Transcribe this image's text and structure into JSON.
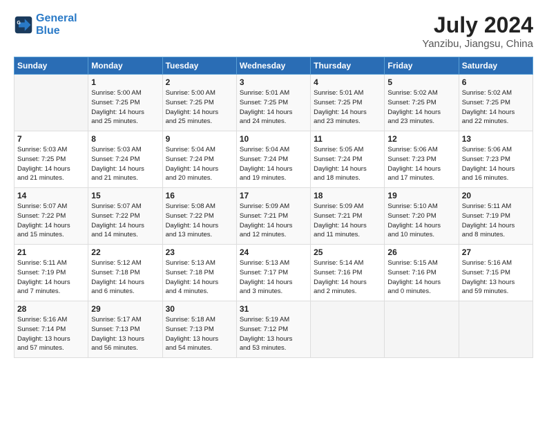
{
  "header": {
    "logo_line1": "General",
    "logo_line2": "Blue",
    "title": "July 2024",
    "subtitle": "Yanzibu, Jiangsu, China"
  },
  "weekdays": [
    "Sunday",
    "Monday",
    "Tuesday",
    "Wednesday",
    "Thursday",
    "Friday",
    "Saturday"
  ],
  "weeks": [
    [
      {
        "day": "",
        "info": ""
      },
      {
        "day": "1",
        "info": "Sunrise: 5:00 AM\nSunset: 7:25 PM\nDaylight: 14 hours\nand 25 minutes."
      },
      {
        "day": "2",
        "info": "Sunrise: 5:00 AM\nSunset: 7:25 PM\nDaylight: 14 hours\nand 25 minutes."
      },
      {
        "day": "3",
        "info": "Sunrise: 5:01 AM\nSunset: 7:25 PM\nDaylight: 14 hours\nand 24 minutes."
      },
      {
        "day": "4",
        "info": "Sunrise: 5:01 AM\nSunset: 7:25 PM\nDaylight: 14 hours\nand 23 minutes."
      },
      {
        "day": "5",
        "info": "Sunrise: 5:02 AM\nSunset: 7:25 PM\nDaylight: 14 hours\nand 23 minutes."
      },
      {
        "day": "6",
        "info": "Sunrise: 5:02 AM\nSunset: 7:25 PM\nDaylight: 14 hours\nand 22 minutes."
      }
    ],
    [
      {
        "day": "7",
        "info": "Sunrise: 5:03 AM\nSunset: 7:25 PM\nDaylight: 14 hours\nand 21 minutes."
      },
      {
        "day": "8",
        "info": "Sunrise: 5:03 AM\nSunset: 7:24 PM\nDaylight: 14 hours\nand 21 minutes."
      },
      {
        "day": "9",
        "info": "Sunrise: 5:04 AM\nSunset: 7:24 PM\nDaylight: 14 hours\nand 20 minutes."
      },
      {
        "day": "10",
        "info": "Sunrise: 5:04 AM\nSunset: 7:24 PM\nDaylight: 14 hours\nand 19 minutes."
      },
      {
        "day": "11",
        "info": "Sunrise: 5:05 AM\nSunset: 7:24 PM\nDaylight: 14 hours\nand 18 minutes."
      },
      {
        "day": "12",
        "info": "Sunrise: 5:06 AM\nSunset: 7:23 PM\nDaylight: 14 hours\nand 17 minutes."
      },
      {
        "day": "13",
        "info": "Sunrise: 5:06 AM\nSunset: 7:23 PM\nDaylight: 14 hours\nand 16 minutes."
      }
    ],
    [
      {
        "day": "14",
        "info": "Sunrise: 5:07 AM\nSunset: 7:22 PM\nDaylight: 14 hours\nand 15 minutes."
      },
      {
        "day": "15",
        "info": "Sunrise: 5:07 AM\nSunset: 7:22 PM\nDaylight: 14 hours\nand 14 minutes."
      },
      {
        "day": "16",
        "info": "Sunrise: 5:08 AM\nSunset: 7:22 PM\nDaylight: 14 hours\nand 13 minutes."
      },
      {
        "day": "17",
        "info": "Sunrise: 5:09 AM\nSunset: 7:21 PM\nDaylight: 14 hours\nand 12 minutes."
      },
      {
        "day": "18",
        "info": "Sunrise: 5:09 AM\nSunset: 7:21 PM\nDaylight: 14 hours\nand 11 minutes."
      },
      {
        "day": "19",
        "info": "Sunrise: 5:10 AM\nSunset: 7:20 PM\nDaylight: 14 hours\nand 10 minutes."
      },
      {
        "day": "20",
        "info": "Sunrise: 5:11 AM\nSunset: 7:19 PM\nDaylight: 14 hours\nand 8 minutes."
      }
    ],
    [
      {
        "day": "21",
        "info": "Sunrise: 5:11 AM\nSunset: 7:19 PM\nDaylight: 14 hours\nand 7 minutes."
      },
      {
        "day": "22",
        "info": "Sunrise: 5:12 AM\nSunset: 7:18 PM\nDaylight: 14 hours\nand 6 minutes."
      },
      {
        "day": "23",
        "info": "Sunrise: 5:13 AM\nSunset: 7:18 PM\nDaylight: 14 hours\nand 4 minutes."
      },
      {
        "day": "24",
        "info": "Sunrise: 5:13 AM\nSunset: 7:17 PM\nDaylight: 14 hours\nand 3 minutes."
      },
      {
        "day": "25",
        "info": "Sunrise: 5:14 AM\nSunset: 7:16 PM\nDaylight: 14 hours\nand 2 minutes."
      },
      {
        "day": "26",
        "info": "Sunrise: 5:15 AM\nSunset: 7:16 PM\nDaylight: 14 hours\nand 0 minutes."
      },
      {
        "day": "27",
        "info": "Sunrise: 5:16 AM\nSunset: 7:15 PM\nDaylight: 13 hours\nand 59 minutes."
      }
    ],
    [
      {
        "day": "28",
        "info": "Sunrise: 5:16 AM\nSunset: 7:14 PM\nDaylight: 13 hours\nand 57 minutes."
      },
      {
        "day": "29",
        "info": "Sunrise: 5:17 AM\nSunset: 7:13 PM\nDaylight: 13 hours\nand 56 minutes."
      },
      {
        "day": "30",
        "info": "Sunrise: 5:18 AM\nSunset: 7:13 PM\nDaylight: 13 hours\nand 54 minutes."
      },
      {
        "day": "31",
        "info": "Sunrise: 5:19 AM\nSunset: 7:12 PM\nDaylight: 13 hours\nand 53 minutes."
      },
      {
        "day": "",
        "info": ""
      },
      {
        "day": "",
        "info": ""
      },
      {
        "day": "",
        "info": ""
      }
    ]
  ]
}
